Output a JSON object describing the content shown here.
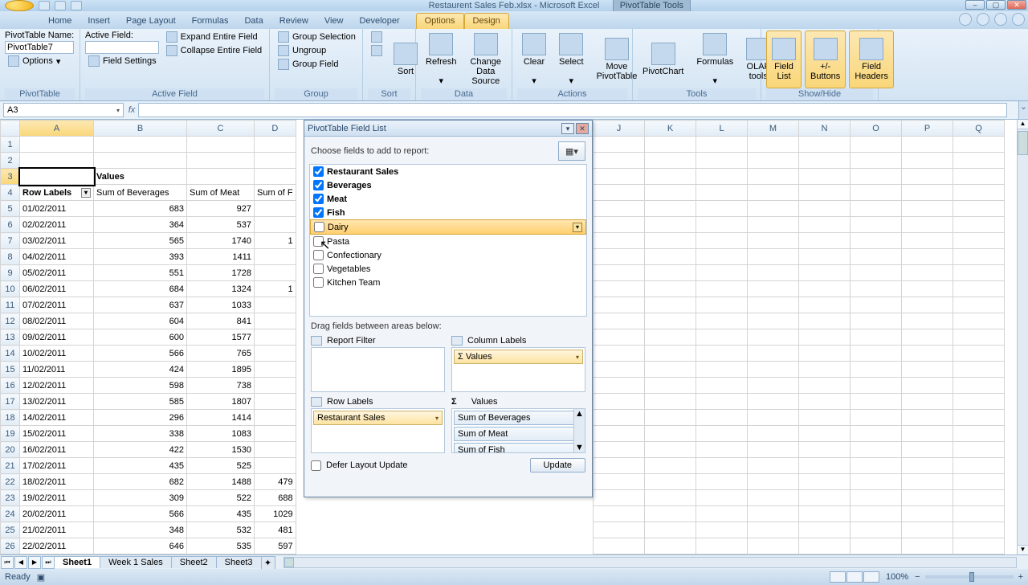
{
  "title": "Restaurent Sales Feb.xlsx - Microsoft Excel",
  "context_tools": "PivotTable Tools",
  "tabs": [
    "Home",
    "Insert",
    "Page Layout",
    "Formulas",
    "Data",
    "Review",
    "View",
    "Developer"
  ],
  "ctx_tabs": [
    "Options",
    "Design"
  ],
  "ribbon": {
    "pt": {
      "name_lbl": "PivotTable Name:",
      "name_val": "PivotTable7",
      "options": "Options",
      "group": "PivotTable"
    },
    "af": {
      "active_lbl": "Active Field:",
      "active_val": "",
      "expand": "Expand Entire Field",
      "collapse": "Collapse Entire Field",
      "settings": "Field Settings",
      "group": "Active Field"
    },
    "grp": {
      "sel": "Group Selection",
      "ungrp": "Ungroup",
      "fld": "Group Field",
      "group": "Group"
    },
    "sort": {
      "sort": "Sort",
      "group": "Sort"
    },
    "data": {
      "refresh": "Refresh",
      "change": "Change Data Source",
      "group": "Data"
    },
    "act": {
      "clear": "Clear",
      "select": "Select",
      "move": "Move PivotTable",
      "group": "Actions"
    },
    "tools": {
      "chart": "PivotChart",
      "form": "Formulas",
      "olap": "OLAP tools",
      "group": "Tools"
    },
    "show": {
      "flist": "Field List",
      "pm": "+/- Buttons",
      "fh": "Field Headers",
      "group": "Show/Hide"
    }
  },
  "namebox": "A3",
  "grid": {
    "cols": [
      "A",
      "B",
      "C",
      "D"
    ],
    "restcols": [
      "J",
      "K",
      "L",
      "M",
      "N",
      "O",
      "P",
      "Q"
    ],
    "values_hdr": "Values",
    "row_labels": "Row Labels",
    "sum_bev": "Sum of Beverages",
    "sum_meat": "Sum of Meat",
    "sum_f": "Sum of F",
    "rows": [
      {
        "r": 5,
        "d": "01/02/2011",
        "b": 683,
        "m": 927,
        "f": ""
      },
      {
        "r": 6,
        "d": "02/02/2011",
        "b": 364,
        "m": 537,
        "f": ""
      },
      {
        "r": 7,
        "d": "03/02/2011",
        "b": 565,
        "m": 1740,
        "f": "1"
      },
      {
        "r": 8,
        "d": "04/02/2011",
        "b": 393,
        "m": 1411,
        "f": ""
      },
      {
        "r": 9,
        "d": "05/02/2011",
        "b": 551,
        "m": 1728,
        "f": ""
      },
      {
        "r": 10,
        "d": "06/02/2011",
        "b": 684,
        "m": 1324,
        "f": "1"
      },
      {
        "r": 11,
        "d": "07/02/2011",
        "b": 637,
        "m": 1033,
        "f": ""
      },
      {
        "r": 12,
        "d": "08/02/2011",
        "b": 604,
        "m": 841,
        "f": ""
      },
      {
        "r": 13,
        "d": "09/02/2011",
        "b": 600,
        "m": 1577,
        "f": ""
      },
      {
        "r": 14,
        "d": "10/02/2011",
        "b": 566,
        "m": 765,
        "f": ""
      },
      {
        "r": 15,
        "d": "11/02/2011",
        "b": 424,
        "m": 1895,
        "f": ""
      },
      {
        "r": 16,
        "d": "12/02/2011",
        "b": 598,
        "m": 738,
        "f": ""
      },
      {
        "r": 17,
        "d": "13/02/2011",
        "b": 585,
        "m": 1807,
        "f": ""
      },
      {
        "r": 18,
        "d": "14/02/2011",
        "b": 296,
        "m": 1414,
        "f": ""
      },
      {
        "r": 19,
        "d": "15/02/2011",
        "b": 338,
        "m": 1083,
        "f": ""
      },
      {
        "r": 20,
        "d": "16/02/2011",
        "b": 422,
        "m": 1530,
        "f": ""
      },
      {
        "r": 21,
        "d": "17/02/2011",
        "b": 435,
        "m": 525,
        "f": ""
      },
      {
        "r": 22,
        "d": "18/02/2011",
        "b": 682,
        "m": 1488,
        "f": "479"
      },
      {
        "r": 23,
        "d": "19/02/2011",
        "b": 309,
        "m": 522,
        "f": "688"
      },
      {
        "r": 24,
        "d": "20/02/2011",
        "b": 566,
        "m": 435,
        "f": "1029"
      },
      {
        "r": 25,
        "d": "21/02/2011",
        "b": 348,
        "m": 532,
        "f": "481"
      },
      {
        "r": 26,
        "d": "22/02/2011",
        "b": 646,
        "m": 535,
        "f": "597"
      }
    ]
  },
  "pane": {
    "title": "PivotTable Field List",
    "choose": "Choose fields to add to report:",
    "fields": [
      {
        "name": "Restaurant Sales",
        "checked": true,
        "bold": true
      },
      {
        "name": "Beverages",
        "checked": true,
        "bold": true
      },
      {
        "name": "Meat",
        "checked": true,
        "bold": true
      },
      {
        "name": "Fish",
        "checked": true,
        "bold": true
      },
      {
        "name": "Dairy",
        "checked": false,
        "bold": false,
        "hl": true
      },
      {
        "name": "Pasta",
        "checked": false,
        "bold": false
      },
      {
        "name": "Confectionary",
        "checked": false,
        "bold": false
      },
      {
        "name": "Vegetables",
        "checked": false,
        "bold": false
      },
      {
        "name": "Kitchen Team",
        "checked": false,
        "bold": false
      }
    ],
    "drag": "Drag fields between areas below:",
    "rf": "Report Filter",
    "cl": "Column Labels",
    "rl": "Row Labels",
    "vl": "Values",
    "rl_chip": "Restaurant Sales",
    "cl_chip": "Values",
    "v_chips": [
      "Sum of Beverages",
      "Sum of Meat",
      "Sum of Fish"
    ],
    "defer": "Defer Layout Update",
    "update": "Update"
  },
  "sheets": [
    "Sheet1",
    "Week 1 Sales",
    "Sheet2",
    "Sheet3"
  ],
  "status": {
    "ready": "Ready",
    "zoom": "100%"
  }
}
